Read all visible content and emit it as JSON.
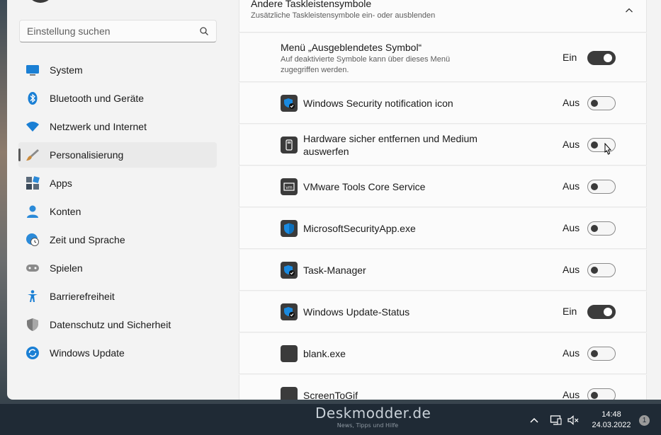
{
  "sidebar": {
    "search": {
      "placeholder": "Einstellung suchen"
    },
    "items": [
      {
        "label": "System",
        "icon": "monitor-icon",
        "color": "#1a7fd4"
      },
      {
        "label": "Bluetooth und Geräte",
        "icon": "bluetooth-icon",
        "color": "#1a7fd4"
      },
      {
        "label": "Netzwerk und Internet",
        "icon": "wifi-icon",
        "color": "#1a7fd4"
      },
      {
        "label": "Personalisierung",
        "icon": "brush-icon",
        "color": "#c98a3c",
        "active": true
      },
      {
        "label": "Apps",
        "icon": "apps-icon",
        "color": "#3b4a5a"
      },
      {
        "label": "Konten",
        "icon": "account-icon",
        "color": "#2b8ad8"
      },
      {
        "label": "Zeit und Sprache",
        "icon": "globe-clock-icon",
        "color": "#2b8ad8"
      },
      {
        "label": "Spielen",
        "icon": "gamepad-icon",
        "color": "#8a8a8a"
      },
      {
        "label": "Barrierefreiheit",
        "icon": "accessibility-icon",
        "color": "#1a7fd4"
      },
      {
        "label": "Datenschutz und Sicherheit",
        "icon": "shield-icon",
        "color": "#7a7a7a"
      },
      {
        "label": "Windows Update",
        "icon": "update-icon",
        "color": "#1a7fd4"
      }
    ]
  },
  "section": {
    "title": "Andere Taskleistensymbole",
    "subtitle": "Zusätzliche Taskleistensymbole ein- oder ausblenden"
  },
  "rows": [
    {
      "label": "Menü „Ausgeblendetes Symbol“",
      "description": "Auf deaktivierte Symbole kann über dieses Menü zugegriffen werden.",
      "state": "Ein",
      "on": true,
      "icon": "none"
    },
    {
      "label": "Windows Security notification icon",
      "state": "Aus",
      "on": false,
      "icon": "security-shield-icon"
    },
    {
      "label": "Hardware sicher entfernen und Medium auswerfen",
      "state": "Aus",
      "on": false,
      "icon": "usb-drive-icon"
    },
    {
      "label": "VMware Tools Core Service",
      "state": "Aus",
      "on": false,
      "icon": "vmware-icon"
    },
    {
      "label": "MicrosoftSecurityApp.exe",
      "state": "Aus",
      "on": false,
      "icon": "defender-shield-icon"
    },
    {
      "label": "Task-Manager",
      "state": "Aus",
      "on": false,
      "icon": "security-shield-icon"
    },
    {
      "label": "Windows Update-Status",
      "state": "Ein",
      "on": true,
      "icon": "security-shield-icon"
    },
    {
      "label": "blank.exe",
      "state": "Aus",
      "on": false,
      "icon": "blank-icon"
    },
    {
      "label": "ScreenToGif",
      "state": "Aus",
      "on": false,
      "icon": "blank-icon"
    }
  ],
  "taskbar": {
    "watermark_title": "Deskmodder.de",
    "watermark_sub": "News, Tipps und Hilfe",
    "time": "14:48",
    "date": "24.03.2022",
    "notification_count": "1"
  }
}
